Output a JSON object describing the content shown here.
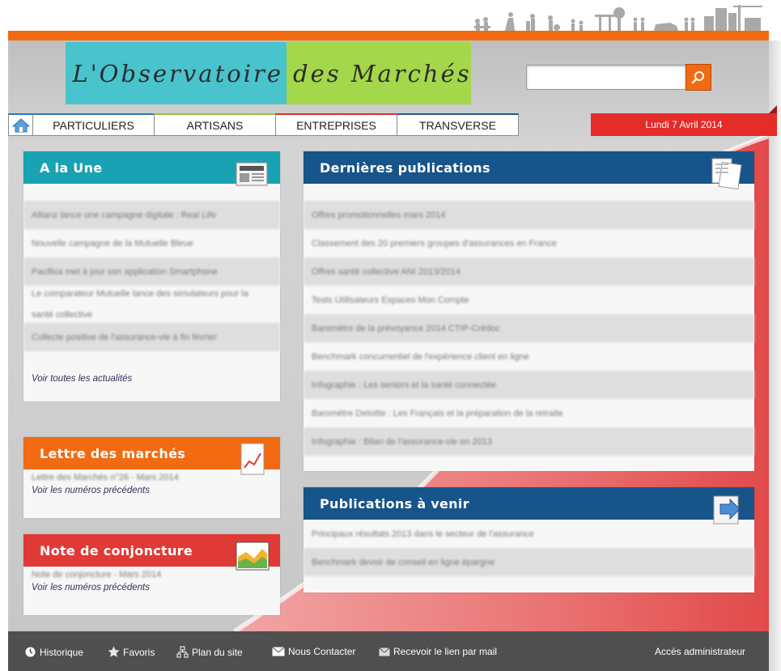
{
  "header": {
    "logo_left": "L'Observatoire",
    "logo_right": "des Marchés",
    "search": {
      "placeholder": "",
      "value": ""
    }
  },
  "nav": {
    "items": [
      {
        "label": "PARTICULIERS",
        "color": "#2d76b5"
      },
      {
        "label": "ARTISANS",
        "color": "#8cc63f"
      },
      {
        "label": "ENTREPRISES",
        "color": "#d9322f"
      },
      {
        "label": "TRANSVERSE",
        "color": "#1f5a8c"
      }
    ],
    "date": "Lundi 7 Avril 2014"
  },
  "une": {
    "title": "A la Une",
    "icon": "newspaper-icon",
    "items": [
      "Allianz lance une campagne digitale : Real Life",
      "Nouvelle campagne de la Mutuelle Bleue",
      "Pacifica met à jour son application Smartphone",
      "Le comparateur Mutuelle lance des simulateurs pour la santé collective",
      "Collecte positive de l'assurance-vie à fin février"
    ],
    "more": "Voir toutes les actualités"
  },
  "lettre": {
    "title": "Lettre des marchés",
    "icon": "chart-document-icon",
    "item": "Lettre des Marchés n°26 - Mars 2014",
    "more": "Voir les numéros précédents"
  },
  "note": {
    "title": "Note de conjoncture",
    "icon": "area-chart-icon",
    "item": "Note de conjoncture - Mars 2014",
    "more": "Voir les numéros précédents"
  },
  "pubs": {
    "title": "Dernières publications",
    "icon": "documents-icon",
    "items": [
      "Offres promotionnelles mars 2014",
      "Classement des 20 premiers groupes d'assurances en France",
      "Offres santé collective ANI 2013/2014",
      "Tests Utilisateurs Espaces Mon Compte",
      "Baromètre de la prévoyance 2014 CTIP-Crédoc",
      "Benchmark concurrentiel de l'expérience client en ligne",
      "Infographie : Les seniors et la santé connectée",
      "Baromètre Deloitte : Les Français et la préparation de la retraite",
      "Infographie : Bilan de l'assurance-vie en 2013"
    ]
  },
  "venir": {
    "title": "Publications à venir",
    "icon": "arrow-right-icon",
    "items": [
      "Principaux résultats 2013 dans le secteur de l'assurance",
      "Benchmark devoir de conseil en ligne épargne"
    ]
  },
  "footer": {
    "links": [
      {
        "label": "Historique",
        "icon": "history-icon"
      },
      {
        "label": "Favoris",
        "icon": "star-icon"
      },
      {
        "label": "Plan du site",
        "icon": "sitemap-icon"
      },
      {
        "label": "Nous Contacter",
        "icon": "envelope-icon"
      },
      {
        "label": "Recevoir le lien par mail",
        "icon": "mail-link-icon"
      }
    ],
    "admin": "Accès administrateur"
  },
  "colors": {
    "orange": "#f26a12",
    "teal": "#19a3b2",
    "red": "#e03a36",
    "navy": "#17548a",
    "green": "#a5d74a",
    "logo_cyan": "#49c3cc"
  }
}
